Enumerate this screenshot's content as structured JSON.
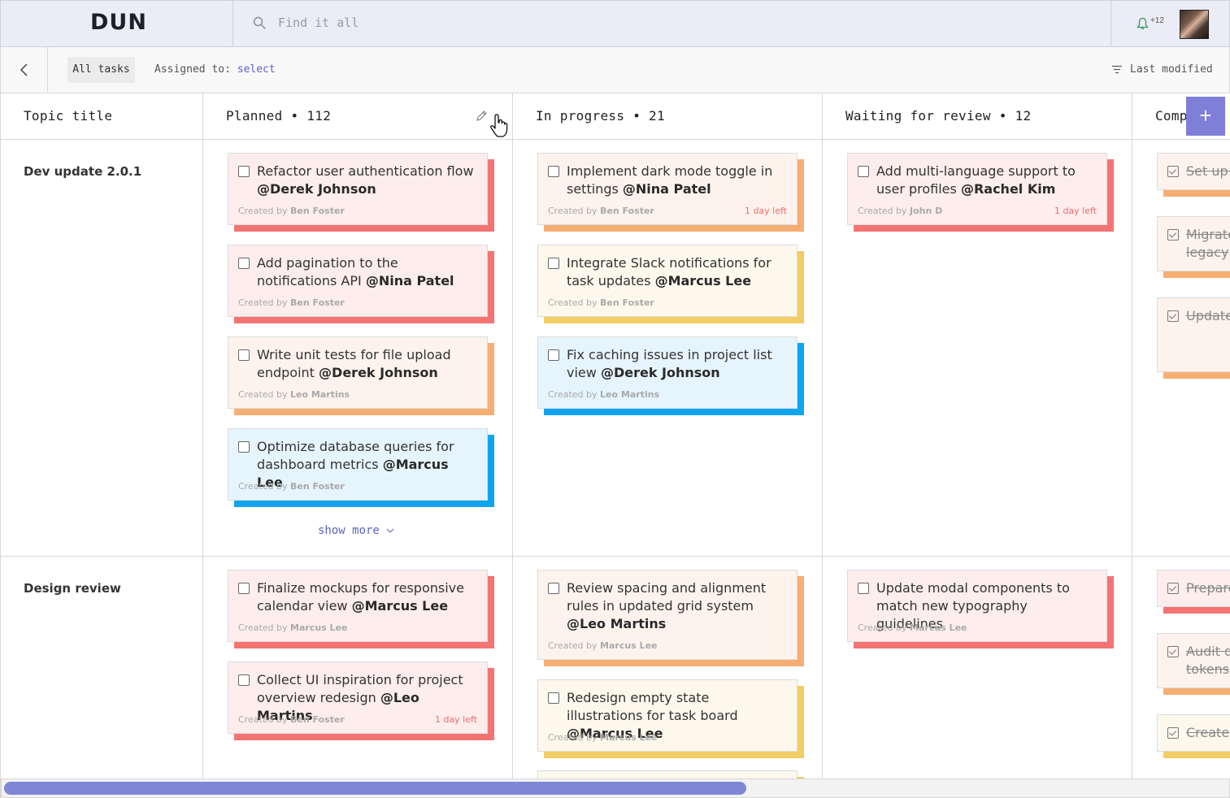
{
  "app": {
    "logo": "DUN"
  },
  "search": {
    "placeholder": "Find it all"
  },
  "user": {
    "notification_count": "+12"
  },
  "toolbar": {
    "all_tasks_label": "All tasks",
    "assigned_label": "Assigned to:",
    "assigned_value": "select",
    "sort_label": "Last modified"
  },
  "columns": {
    "topic": "Topic title",
    "planned": "Planned • 112",
    "in_progress": "In progress • 21",
    "waiting": "Waiting for review • 12",
    "completed": "Comp"
  },
  "rows": [
    {
      "title": "Dev update 2.0.1"
    },
    {
      "title": "Design review"
    }
  ],
  "cards": {
    "r0p0": {
      "text": "Refactor user authentication flow",
      "mention": "@Derek Johnson",
      "created": "Created by",
      "creator": "Ben Foster",
      "color": "#f47373"
    },
    "r0p1": {
      "text": "Add pagination to the notifications API",
      "mention": "@Nina Patel",
      "created": "Created by",
      "creator": "Ben Foster",
      "color": "#f47373"
    },
    "r0p2": {
      "text": "Write unit tests for file upload endpoint",
      "mention": "@Derek Johnson",
      "created": "Created by",
      "creator": "Leo Martins",
      "color": "#f7ae72"
    },
    "r0p3": {
      "text": "Optimize database queries for dashboard metrics",
      "mention": "@Marcus Lee",
      "created": "Created by",
      "creator": "Ben Foster",
      "color": "#0ea5f0"
    },
    "r0i0": {
      "text": "Implement dark mode toggle in settings",
      "mention": "@Nina Patel",
      "created": "Created by",
      "creator": "Ben Foster",
      "due": "1 day left",
      "color": "#f7ae72"
    },
    "r0i1": {
      "text": "Integrate Slack notifications for task updates",
      "mention": "@Marcus Lee",
      "created": "Created by",
      "creator": "Ben Foster",
      "color": "#f2cd64"
    },
    "r0i2": {
      "text": "Fix caching issues in project list view",
      "mention": "@Derek Johnson",
      "created": "Created by",
      "creator": "Leo Martins",
      "color": "#0ea5f0"
    },
    "r0w0": {
      "text": "Add multi-language support to user profiles",
      "mention": "@Rachel Kim",
      "created": "Created by",
      "creator": "John D",
      "due": "1 day left",
      "color": "#f47373"
    },
    "r1p0": {
      "text": "Finalize mockups for responsive calendar view",
      "mention": "@Marcus Lee",
      "created": "Created by",
      "creator": "Marcus Lee",
      "color": "#f47373"
    },
    "r1p1": {
      "text": "Collect UI inspiration for project overview redesign",
      "mention": "@Leo Martins",
      "created": "Created by",
      "creator": "Ben Foster",
      "due": "1 day left",
      "color": "#f47373"
    },
    "r1i0": {
      "text": "Review spacing and alignment rules in updated grid system",
      "mention": "@Leo Martins",
      "created": "Created by",
      "creator": "Marcus Lee",
      "color": "#f7ae72"
    },
    "r1i1": {
      "text": "Redesign empty state illustrations for task board",
      "mention": "@Marcus Lee",
      "created": "Created by",
      "creator": "Marcus Lee",
      "color": "#f2cd64"
    },
    "r1w0": {
      "text": "Update modal components to match new typography guidelines",
      "mention": "",
      "created": "Created by",
      "creator": "Marcus Lee",
      "color": "#f47373"
    }
  },
  "completed": {
    "r0c0": "Set up s",
    "r0c1": "Migrate legacy",
    "r0c2": "Update",
    "r1c0": "Prepare",
    "r1c1": "Audit d tokens",
    "r1c2": "Create"
  },
  "show_more": "show more",
  "icons": {
    "search": "search-icon",
    "bell": "bell-icon",
    "back": "chevron-left-icon",
    "sort": "sort-icon",
    "edit": "pencil-icon",
    "add": "plus-icon"
  },
  "scroll": {
    "horizontal_position": 0.6
  }
}
